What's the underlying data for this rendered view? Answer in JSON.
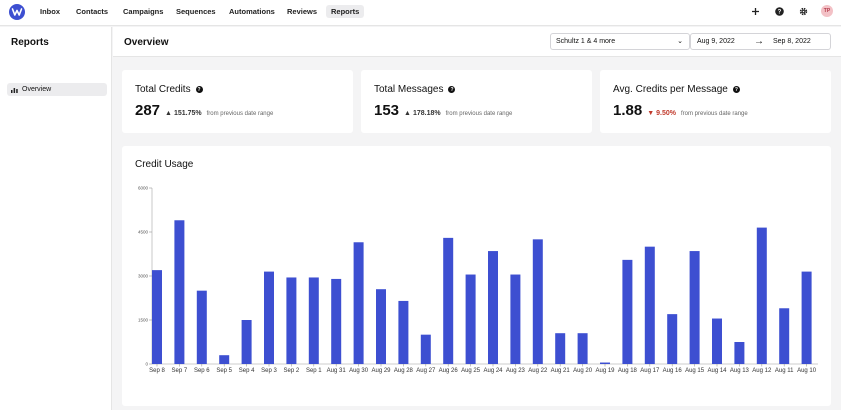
{
  "nav": {
    "items": [
      "Inbox",
      "Contacts",
      "Campaigns",
      "Sequences",
      "Automations",
      "Reviews",
      "Reports"
    ],
    "active": "Reports",
    "avatar_initials": "TP"
  },
  "sidebar": {
    "title": "Reports",
    "items": [
      {
        "label": "Overview",
        "icon": "bar-chart-icon"
      }
    ]
  },
  "header": {
    "title": "Overview",
    "location_select": "Schultz 1 & 4 more",
    "date_from": "Aug 9, 2022",
    "date_to": "Sep 8, 2022"
  },
  "stats": [
    {
      "title": "Total Credits",
      "value": "287",
      "direction": "up",
      "change": "151.75%",
      "note": "from previous date range"
    },
    {
      "title": "Total Messages",
      "value": "153",
      "direction": "up",
      "change": "178.18%",
      "note": "from previous date range"
    },
    {
      "title": "Avg. Credits per Message",
      "value": "1.88",
      "direction": "down",
      "change": "9.50%",
      "note": "from previous date range"
    }
  ],
  "colors": {
    "bar": "#3d4fd1",
    "accent": "#3d4fd1",
    "down": "#c0392b"
  },
  "chart_data": {
    "type": "bar",
    "title": "Credit Usage",
    "xlabel": "",
    "ylabel": "",
    "ylim": [
      0,
      6000
    ],
    "yticks": [
      "6000",
      "4500",
      "3000",
      "1500",
      "0"
    ],
    "categories": [
      "Sep 8",
      "Sep 7",
      "Sep 6",
      "Sep 5",
      "Sep 4",
      "Sep 3",
      "Sep 2",
      "Sep 1",
      "Aug 31",
      "Aug 30",
      "Aug 29",
      "Aug 28",
      "Aug 27",
      "Aug 26",
      "Aug 25",
      "Aug 24",
      "Aug 23",
      "Aug 22",
      "Aug 21",
      "Aug 20",
      "Aug 19",
      "Aug 18",
      "Aug 17",
      "Aug 16",
      "Aug 15",
      "Aug 14",
      "Aug 13",
      "Aug 12",
      "Aug 11",
      "Aug 10"
    ],
    "values": [
      3200,
      4900,
      2500,
      300,
      1500,
      3150,
      2950,
      2950,
      2900,
      4150,
      2550,
      2150,
      1000,
      4300,
      3050,
      3850,
      3050,
      4250,
      1050,
      1050,
      50,
      3550,
      4000,
      1700,
      3850,
      1550,
      750,
      4650,
      1900,
      3150
    ],
    "grid": false
  }
}
